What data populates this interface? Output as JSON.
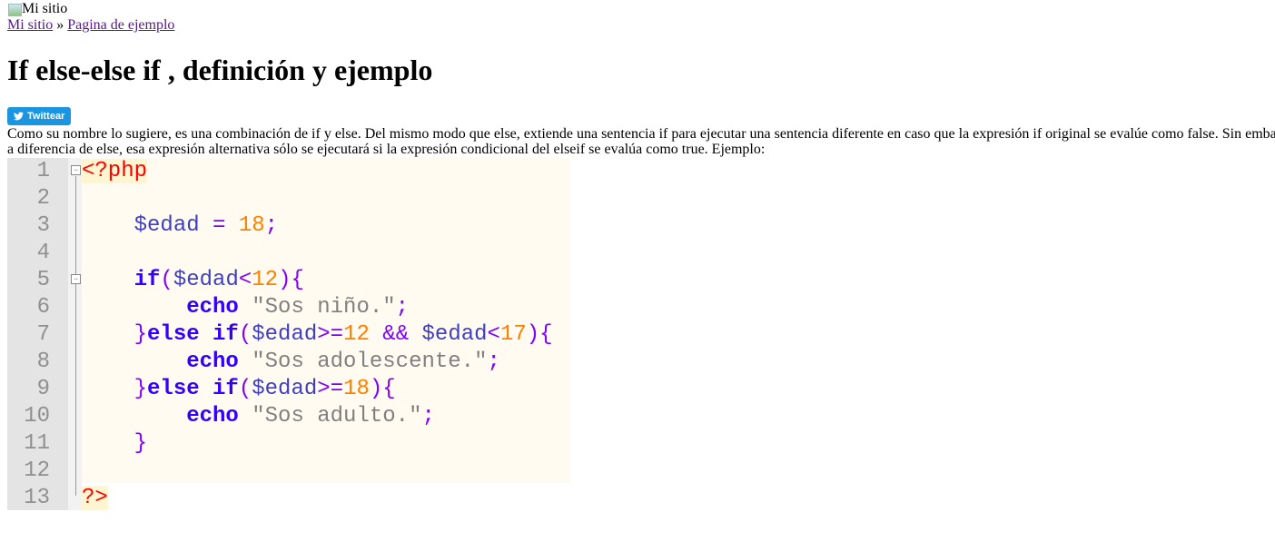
{
  "header": {
    "logo_alt": "Mi sitio"
  },
  "breadcrumb": {
    "home": "Mi sitio",
    "separator": "»",
    "current": "Pagina de ejemplo"
  },
  "article": {
    "title": "If else-else if , definición y ejemplo",
    "tweet_button": "Twittear",
    "paragraph_line1": "Como su nombre lo sugiere, es una combinación de if y else. Del mismo modo que else, extiende una sentencia if para ejecutar una sentencia diferente en caso que la expresión if original se evalúe como false. Sin emba",
    "paragraph_line2": "a diferencia de else, esa expresión alternativa sólo se ejecutará si la expresión condicional del elseif se evalúa como true. Ejemplo:"
  },
  "code": {
    "lines": [
      [
        [
          "tag",
          "<?php"
        ]
      ],
      [],
      [
        [
          "ws",
          "    "
        ],
        [
          "var",
          "$edad"
        ],
        [
          "ws",
          " "
        ],
        [
          "op",
          "="
        ],
        [
          "ws",
          " "
        ],
        [
          "num",
          "18"
        ],
        [
          "op",
          ";"
        ]
      ],
      [],
      [
        [
          "ws",
          "    "
        ],
        [
          "kw",
          "if"
        ],
        [
          "op",
          "("
        ],
        [
          "var",
          "$edad"
        ],
        [
          "op",
          "<"
        ],
        [
          "num",
          "12"
        ],
        [
          "op",
          "){"
        ]
      ],
      [
        [
          "ws",
          "        "
        ],
        [
          "kw",
          "echo"
        ],
        [
          "ws",
          " "
        ],
        [
          "str",
          "\"Sos niño.\""
        ],
        [
          "op",
          ";"
        ]
      ],
      [
        [
          "ws",
          "    "
        ],
        [
          "op",
          "}"
        ],
        [
          "kw",
          "else if"
        ],
        [
          "op",
          "("
        ],
        [
          "var",
          "$edad"
        ],
        [
          "op",
          ">="
        ],
        [
          "num",
          "12"
        ],
        [
          "ws",
          " "
        ],
        [
          "op",
          "&&"
        ],
        [
          "ws",
          " "
        ],
        [
          "var",
          "$edad"
        ],
        [
          "op",
          "<"
        ],
        [
          "num",
          "17"
        ],
        [
          "op",
          "){"
        ]
      ],
      [
        [
          "ws",
          "        "
        ],
        [
          "kw",
          "echo"
        ],
        [
          "ws",
          " "
        ],
        [
          "str",
          "\"Sos adolescente.\""
        ],
        [
          "op",
          ";"
        ]
      ],
      [
        [
          "ws",
          "    "
        ],
        [
          "op",
          "}"
        ],
        [
          "kw",
          "else if"
        ],
        [
          "op",
          "("
        ],
        [
          "var",
          "$edad"
        ],
        [
          "op",
          ">="
        ],
        [
          "num",
          "18"
        ],
        [
          "op",
          "){"
        ]
      ],
      [
        [
          "ws",
          "        "
        ],
        [
          "kw",
          "echo"
        ],
        [
          "ws",
          " "
        ],
        [
          "str",
          "\"Sos adulto.\""
        ],
        [
          "op",
          ";"
        ]
      ],
      [
        [
          "ws",
          "    "
        ],
        [
          "op",
          "}"
        ]
      ],
      [],
      [
        [
          "tag",
          "?>"
        ]
      ]
    ]
  }
}
